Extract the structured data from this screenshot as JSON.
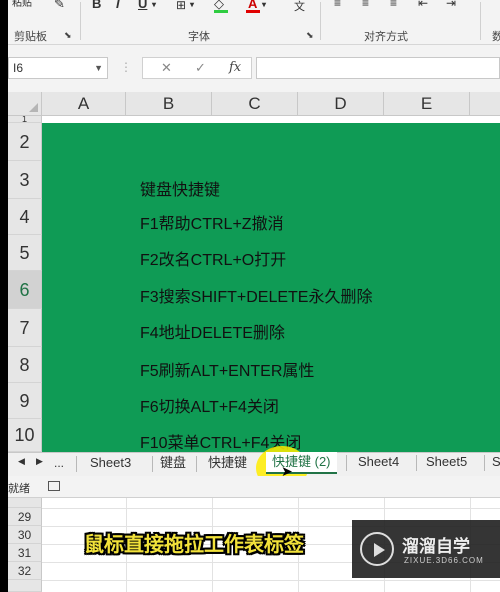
{
  "ribbon": {
    "groups": [
      "剪贴板",
      "字体",
      "对齐方式"
    ],
    "font_buttons": [
      "B",
      "I",
      "U"
    ],
    "clipboard_top": "粘贴"
  },
  "formula_bar": {
    "name_box": "I6",
    "cancel_glyph": "✕",
    "enter_glyph": "✓",
    "fx_label": "fx"
  },
  "grid": {
    "columns": [
      "A",
      "B",
      "C",
      "D",
      "E"
    ],
    "rows": [
      "1",
      "2",
      "3",
      "4",
      "5",
      "6",
      "7",
      "8",
      "9",
      "10"
    ],
    "selected_row": "6",
    "fill_color": "#0f9b55",
    "lines": [
      "键盘快捷键",
      "F1帮助CTRL+Z撤消",
      "F2改名CTRL+O打开",
      "F3搜索SHIFT+DELETE永久删除",
      "F4地址DELETE删除",
      "F5刷新ALT+ENTER属性",
      "F6切换ALT+F4关闭",
      "F10菜单CTRL+F4关闭"
    ]
  },
  "sheet_tabs": {
    "nav_prev": "◀",
    "nav_next": "▶",
    "more": "...",
    "tabs": [
      "Sheet3",
      "键盘",
      "快捷键",
      "快捷键 (2)",
      "Sheet4",
      "Sheet5",
      "S"
    ],
    "active": "快捷键 (2)"
  },
  "status_bar": {
    "mode": "就绪"
  },
  "lower_rows": [
    "29",
    "30",
    "31",
    "32"
  ],
  "subtitle": "鼠标直接拖拉工作表标签",
  "watermark": {
    "title": "溜溜自学",
    "url": "ZIXUE.3D66.COM"
  },
  "colors": {
    "accent": "#217346",
    "subtitle": "#f2e23a",
    "highlight": "#ffec00"
  }
}
